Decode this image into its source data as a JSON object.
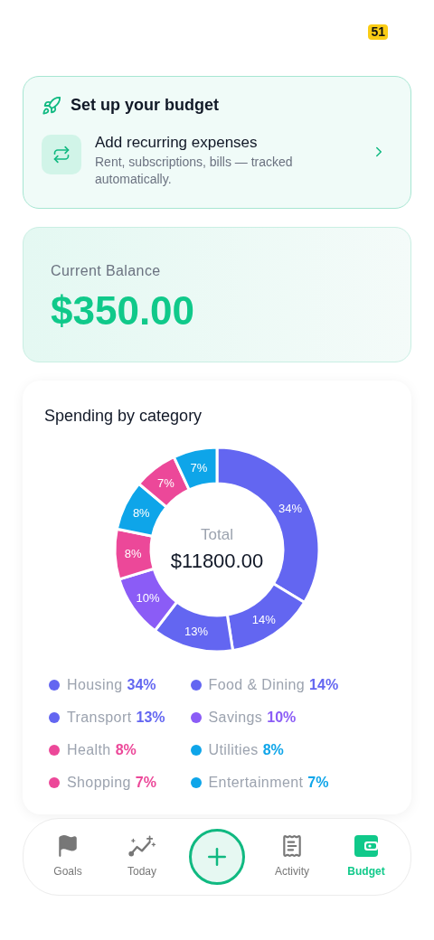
{
  "status_badge": "51",
  "setup_card": {
    "title": "Set up your budget",
    "item": {
      "title": "Add recurring expenses",
      "subtitle": "Rent, subscriptions, bills — tracked automatically."
    }
  },
  "balance": {
    "label": "Current Balance",
    "amount": "$350.00"
  },
  "spending": {
    "title": "Spending by category",
    "center_label": "Total",
    "center_value": "$11800.00",
    "chart_data": {
      "type": "donut",
      "values": [
        34,
        14,
        13,
        10,
        8,
        8,
        7,
        7
      ],
      "colors": [
        "#6366f1",
        "#6366f1",
        "#6366f1",
        "#8b5cf6",
        "#ec4899",
        "#0ea5e9",
        "#ec4899",
        "#0ea5e9"
      ],
      "value_labels": [
        "34%",
        "14%",
        "13%",
        "10%",
        "8%",
        "8%",
        "7%",
        "7%"
      ]
    },
    "legend": [
      {
        "name": "Housing",
        "percent": "34%",
        "color": "#6366f1"
      },
      {
        "name": "Food & Dining",
        "percent": "14%",
        "color": "#6366f1"
      },
      {
        "name": "Transport",
        "percent": "13%",
        "color": "#6366f1"
      },
      {
        "name": "Savings",
        "percent": "10%",
        "color": "#8b5cf6"
      },
      {
        "name": "Health",
        "percent": "8%",
        "color": "#ec4899"
      },
      {
        "name": "Utilities",
        "percent": "8%",
        "color": "#0ea5e9"
      },
      {
        "name": "Shopping",
        "percent": "7%",
        "color": "#ec4899"
      },
      {
        "name": "Entertainment",
        "percent": "7%",
        "color": "#0ea5e9"
      }
    ]
  },
  "nav": [
    {
      "kind": "tab",
      "label": "Goals",
      "selected": false
    },
    {
      "kind": "tab",
      "label": "Today",
      "selected": false
    },
    {
      "kind": "add"
    },
    {
      "kind": "tab",
      "label": "Activity",
      "selected": false
    },
    {
      "kind": "tab",
      "label": "Budget",
      "selected": true
    }
  ]
}
